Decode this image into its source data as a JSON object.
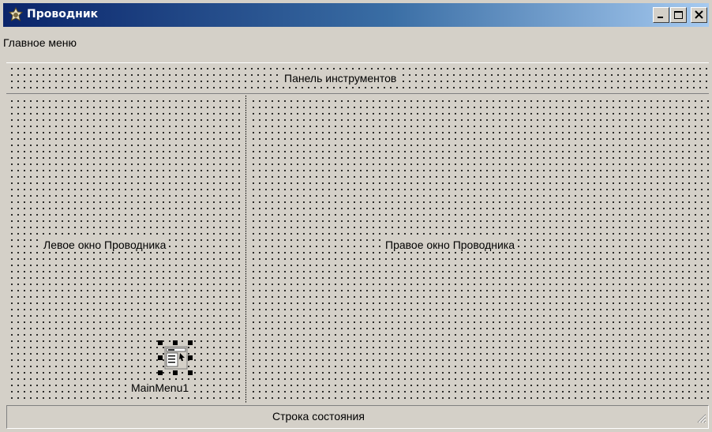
{
  "window": {
    "title": "Проводник",
    "title_icon": "explorer-app-icon",
    "controls": [
      "minimize-icon",
      "maximize-icon",
      "close-icon"
    ]
  },
  "menubar": {
    "label": "Главное меню"
  },
  "toolbar": {
    "caption": "Панель инструментов"
  },
  "left_panel": {
    "caption": "Левое окно Проводника",
    "component": {
      "icon": "main-menu-component-icon",
      "label": "MainMenu1"
    }
  },
  "right_panel": {
    "caption": "Правое окно Проводника"
  },
  "statusbar": {
    "text": "Строка состояния",
    "grip_icon": "size-grip-icon"
  },
  "colors": {
    "titlebar_start": "#0a246a",
    "titlebar_end": "#a6caf0",
    "face": "#d4d0c8"
  }
}
